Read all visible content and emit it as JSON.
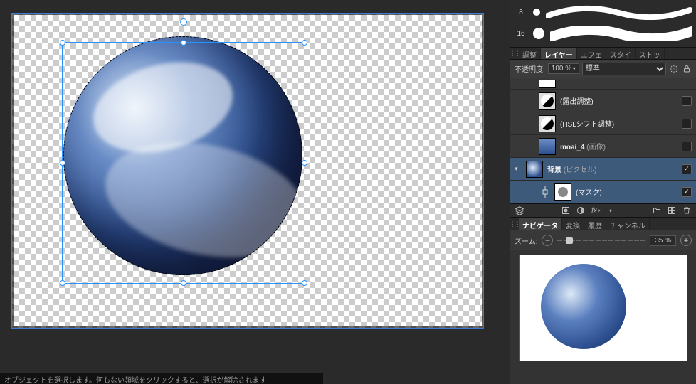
{
  "statusbar": "オブジェクトを選択します。何もない領域をクリックすると、選択が解除されます",
  "brush_sizes": [
    "8",
    "16"
  ],
  "panel_tabs": {
    "adjust": "調整",
    "layers": "レイヤー",
    "effects": "エフェ",
    "styles": "スタイ",
    "stock": "ストッ"
  },
  "opacity": {
    "label": "不透明度:",
    "value": "100 %",
    "blend_mode": "標準"
  },
  "layers": {
    "exposure": {
      "name": "(露出調整)"
    },
    "hsl": {
      "name": "(HSLシフト調整)"
    },
    "moai": {
      "name": "moai_4",
      "suffix": " (画像)"
    },
    "background": {
      "name": "背景",
      "suffix": " (ピクセル)"
    },
    "mask": {
      "name": "(マスク)"
    }
  },
  "nav_tabs": {
    "navigator": "ナビゲータ",
    "transform": "変換",
    "history": "履歴",
    "channels": "チャンネル"
  },
  "zoom": {
    "label": "ズーム:",
    "value": "35 %"
  }
}
